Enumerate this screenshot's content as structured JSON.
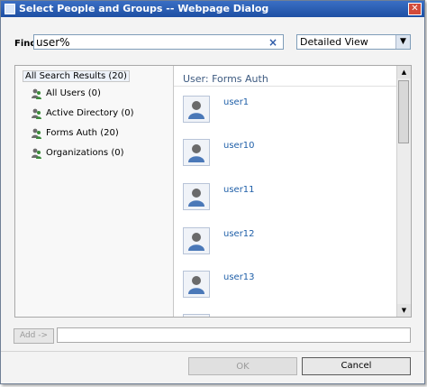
{
  "window": {
    "title": "Select People and Groups -- Webpage Dialog"
  },
  "find": {
    "label": "Find",
    "value": "user%",
    "clear_icon": "×"
  },
  "view": {
    "selected": "Detailed View",
    "arrow": "▼"
  },
  "tree": {
    "root_label": "All Search Results (20)",
    "items": [
      {
        "label": "All Users (0)",
        "icon": "users-group-icon"
      },
      {
        "label": "Active Directory (0)",
        "icon": "users-group-icon"
      },
      {
        "label": "Forms Auth (20)",
        "icon": "users-group-icon"
      },
      {
        "label": "Organizations (0)",
        "icon": "users-group-icon"
      }
    ]
  },
  "results": {
    "header": "User: Forms Auth",
    "users": [
      {
        "name": "user1"
      },
      {
        "name": "user10"
      },
      {
        "name": "user11"
      },
      {
        "name": "user12"
      },
      {
        "name": "user13"
      }
    ]
  },
  "actions": {
    "add_label": "Add ->",
    "ok_label": "OK",
    "cancel_label": "Cancel"
  },
  "colors": {
    "title_bar": "#1e4fa3",
    "link": "#1f5fa8",
    "disabled_text": "#9a9a9a"
  }
}
